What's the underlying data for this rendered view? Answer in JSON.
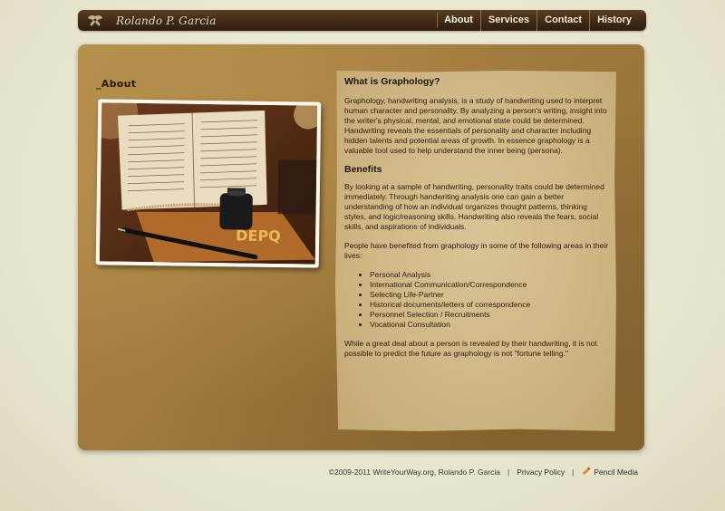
{
  "site": {
    "name": "Rolando P. Garcia"
  },
  "nav": {
    "items": [
      {
        "label": "About"
      },
      {
        "label": "Services"
      },
      {
        "label": "Contact"
      },
      {
        "label": "History"
      }
    ],
    "active": "About"
  },
  "about": {
    "heading": "_About",
    "photo_icon": "journal-photo"
  },
  "content": {
    "section1_title": "What is Graphology?",
    "section1_text": "Graphology, handwriting analysis, is a study of handwriting used to interpret human character and personality. By analyzing a person's writing, insight into the writer's physical, mental, and emotional state could be determined. Handwriting reveals the essentials of personality and character including hidden talents and potential areas of growth. In essence graphology is a valuable tool used to help understand the inner being (persona).",
    "section2_title": "Benefits",
    "section2_text1": "By looking at a sample of handwriting, personality traits could be determined immediately. Through handwriting analysis one can gain a better understanding of how an individual organizes thought patterns, thinking styles, and logic/reasoning skills. Handwriting also reveals the fears, social skills, and aspirations of individuals.",
    "section2_text2": "People have benefited from graphology in some of the following areas in their lives:",
    "benefit_list": [
      "Personal Analysis",
      "International Communication/Correspondence",
      "Selecting Life-Partner",
      "Historical documents/letters of correspondence",
      "Personnel Selection / Recruitments",
      "Vocational Consultation"
    ],
    "closing_text": "While a great deal about a person is revealed by their handwriting, it is not possible to predict the future as graphology is not \"fortune telling.\""
  },
  "footer": {
    "copyright": "©2009-2011 WriteYourWay.org, Rolando P. Garcia",
    "privacy_label": "Privacy Policy",
    "credit_label": "Pencil Media"
  },
  "colors": {
    "nav_bg": "#3c2814",
    "panel_bg": "#a17c3e",
    "paper_bg": "#d8c497",
    "page_bg": "#e6e4cc"
  }
}
